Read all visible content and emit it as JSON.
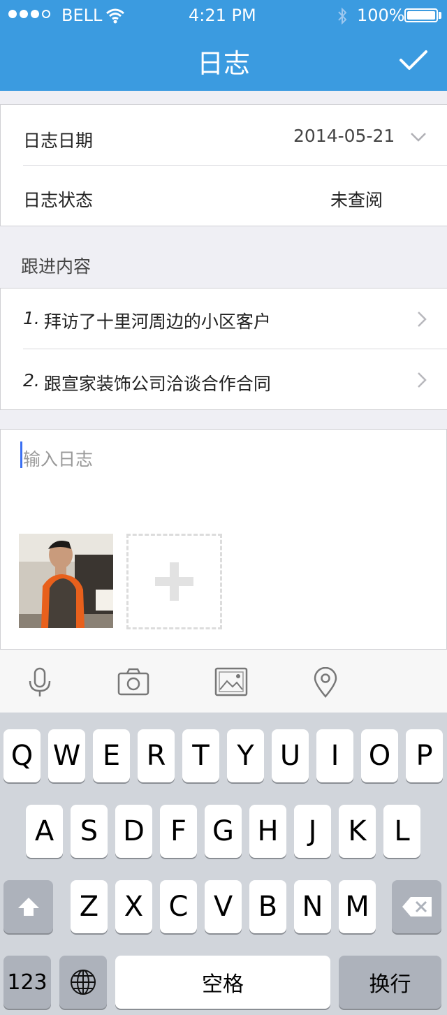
{
  "status_bar": {
    "carrier": "BELL",
    "time": "4:21 PM",
    "battery": "100%"
  },
  "nav": {
    "title": "日志"
  },
  "log_info": {
    "date_label": "日志日期",
    "date_value": "2014-05-21",
    "status_label": "日志状态",
    "status_value": "未查阅"
  },
  "followup": {
    "header": "跟进内容",
    "items": [
      {
        "index": "1.",
        "text": "拜访了十里河周边的小区客户"
      },
      {
        "index": "2.",
        "text": "跟宣家装饰公司洽谈合作合同"
      }
    ]
  },
  "composer": {
    "placeholder": "输入日志"
  },
  "toolbar": {
    "icons": [
      "microphone-icon",
      "camera-icon",
      "image-icon",
      "location-icon"
    ]
  },
  "keyboard": {
    "row1": [
      "Q",
      "W",
      "E",
      "R",
      "T",
      "Y",
      "U",
      "I",
      "O",
      "P"
    ],
    "row2": [
      "A",
      "S",
      "D",
      "F",
      "G",
      "H",
      "J",
      "K",
      "L"
    ],
    "row3": [
      "Z",
      "X",
      "C",
      "V",
      "B",
      "N",
      "M"
    ],
    "numbers": "123",
    "space": "空格",
    "return": "换行"
  },
  "colors": {
    "accent": "#3b9be0",
    "caret": "#3a6ff2"
  }
}
